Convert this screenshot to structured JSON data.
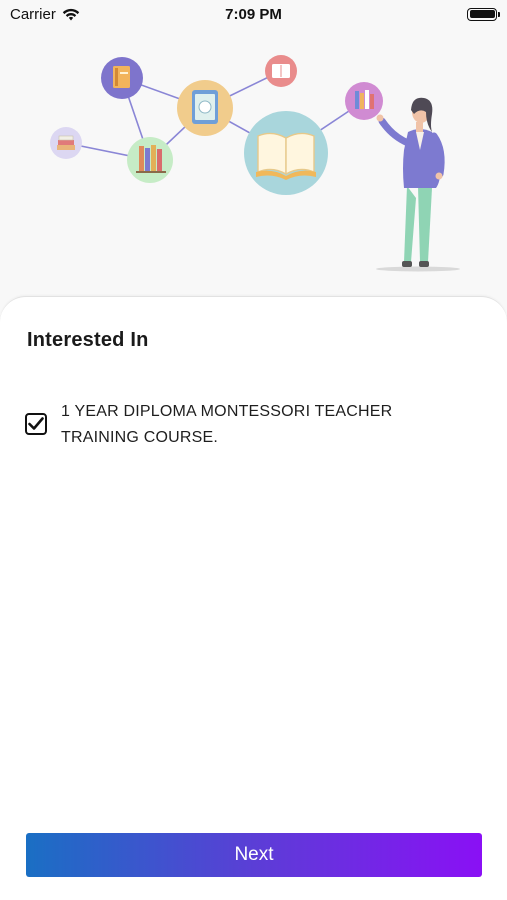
{
  "status_bar": {
    "carrier": "Carrier",
    "time": "7:09 PM",
    "icons": [
      "wifi-icon",
      "battery-icon"
    ]
  },
  "illustration": {
    "subject": "teacher-with-book-network",
    "icons": [
      "book-stack-icon",
      "books-icon",
      "book-cover-icon",
      "open-book-icon",
      "tablet-icon",
      "bookshelf-icon"
    ]
  },
  "interest": {
    "title": "Interested In",
    "options": [
      {
        "label": "1 YEAR DIPLOMA MONTESSORI TEACHER TRAINING COURSE.",
        "checked": true
      }
    ]
  },
  "actions": {
    "next_label": "Next"
  },
  "colors": {
    "gradient_start": "#1a6fc4",
    "gradient_end": "#8a10f5",
    "card_background": "#ffffff",
    "page_background": "#f8f8f8"
  }
}
